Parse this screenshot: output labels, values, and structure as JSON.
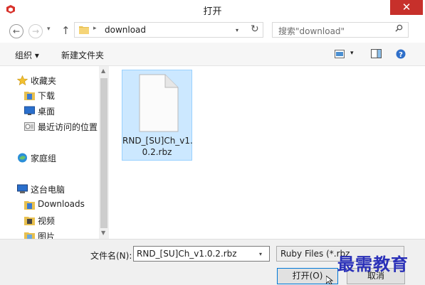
{
  "window": {
    "title": "打开",
    "close_glyph": "✕"
  },
  "navigation": {
    "back_glyph": "←",
    "forward_glyph": "→",
    "history_glyph": "▾",
    "up_glyph": "↑",
    "breadcrumb_separator": "▸",
    "address_path": "download",
    "address_dropdown": "▾",
    "refresh_glyph": "↻",
    "search_placeholder": "搜索\"download\""
  },
  "toolbar": {
    "organize_label": "组织 ▾",
    "new_folder_label": "新建文件夹",
    "view_dropdown": "▾"
  },
  "sidebar": {
    "items": [
      {
        "label": "收藏夹",
        "icon": "star-icon"
      },
      {
        "label": "下载",
        "icon": "download-folder-icon"
      },
      {
        "label": "桌面",
        "icon": "desktop-icon"
      },
      {
        "label": "最近访问的位置",
        "icon": "recent-places-icon"
      },
      {
        "label": "家庭组",
        "icon": "homegroup-icon"
      },
      {
        "label": "这台电脑",
        "icon": "computer-icon"
      },
      {
        "label": "Downloads",
        "icon": "downloads-folder-icon"
      },
      {
        "label": "视频",
        "icon": "videos-folder-icon"
      },
      {
        "label": "图片",
        "icon": "pictures-folder-icon"
      }
    ],
    "scroll_up": "▲",
    "scroll_down": "▼"
  },
  "files": [
    {
      "name": "RND_[SU]Ch_v1.\n0.2.rbz",
      "selected": true
    }
  ],
  "footer": {
    "filename_label": "文件名(N):",
    "filename_value": "RND_[SU]Ch_v1.0.2.rbz",
    "filename_dropdown": "▾",
    "filetype_value": "Ruby Files (*.rbz",
    "open_button": "打开(O)",
    "cancel_button": "取消"
  },
  "watermark": "最需教育",
  "colors": {
    "accent": "#0078d7",
    "selection": "#cce8ff",
    "close": "#c7302b",
    "watermark": "#2a30b8"
  }
}
